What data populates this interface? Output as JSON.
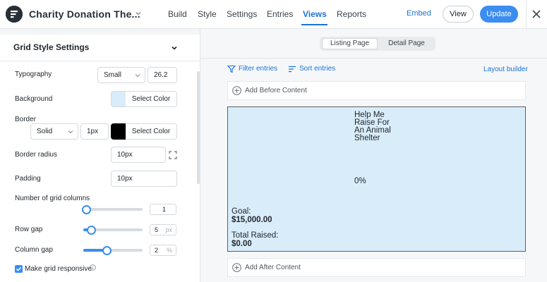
{
  "app": {
    "title": "Charity Donation The...",
    "nav": [
      "Build",
      "Style",
      "Settings",
      "Entries",
      "Views",
      "Reports"
    ],
    "active_nav": "Views",
    "embed_label": "Embed",
    "view_label": "View",
    "update_label": "Update",
    "accent_color": "#3b8df0",
    "icons": [
      "formidable-logo-icon",
      "chevron-down-icon",
      "close-icon"
    ]
  },
  "panel": {
    "section_title": "Grid Style Settings",
    "typography": {
      "label": "Typography",
      "size_value": "Small",
      "number_value": "26.2"
    },
    "background": {
      "label": "Background",
      "swatch_color": "#d9ecfa",
      "button_label": "Select Color"
    },
    "border": {
      "label": "Border",
      "style_value": "Solid",
      "width_value": "1px",
      "swatch_color": "#000000",
      "button_label": "Select Color"
    },
    "border_radius": {
      "label": "Border radius",
      "value": "10px"
    },
    "padding": {
      "label": "Padding",
      "value": "10px"
    },
    "grid_columns": {
      "label": "Number of grid columns",
      "value": "1"
    },
    "row_gap": {
      "label": "Row gap",
      "value": "5",
      "unit": "px"
    },
    "column_gap": {
      "label": "Column gap",
      "value": "2",
      "unit": "%"
    },
    "responsive": {
      "label": "Make grid responsive",
      "checked": true
    }
  },
  "preview": {
    "tabs": [
      "Listing Page",
      "Detail Page"
    ],
    "active_tab": "Listing Page",
    "filter_label": "Filter entries",
    "sort_label": "Sort entries",
    "layout_builder_label": "Layout builder",
    "add_before_label": "Add Before Content",
    "add_after_label": "Add After Content",
    "card": {
      "background": "#d9ecfa",
      "title_lines": [
        "Help Me",
        "Raise For",
        "An Animal",
        "Shelter"
      ],
      "percent": "0%",
      "goal_label": "Goal:",
      "goal_value": "$15,000.00",
      "raised_label": "Total Raised:",
      "raised_value": "$0.00"
    }
  }
}
